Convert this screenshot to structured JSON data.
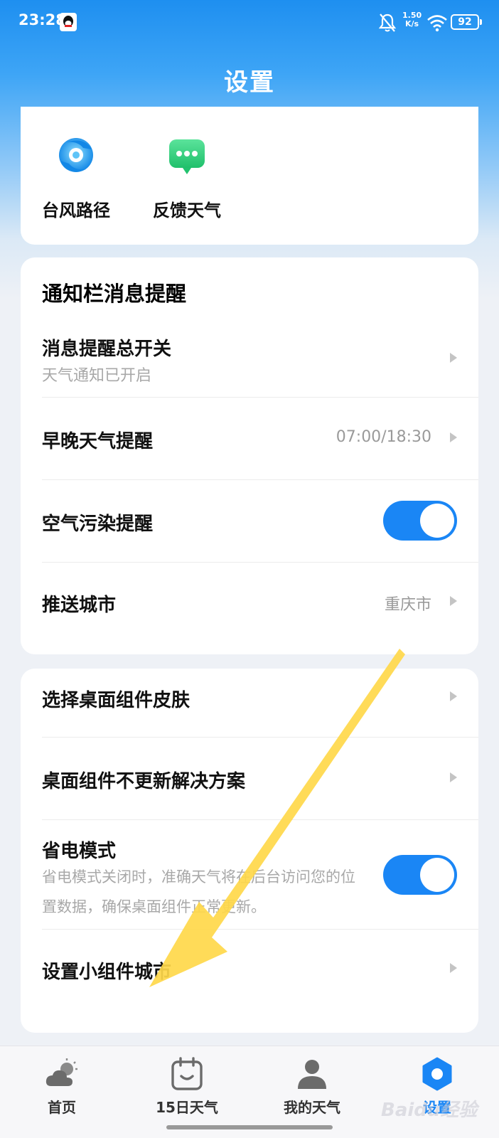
{
  "status_bar": {
    "time": "23:28",
    "net_speed_value": "1.50",
    "net_speed_unit": "K/s",
    "battery": "92"
  },
  "page": {
    "title": "设置"
  },
  "tools": [
    {
      "label": "台风路径",
      "icon": "typhoon-icon"
    },
    {
      "label": "反馈天气",
      "icon": "chat-bubble-icon"
    }
  ],
  "notify_card": {
    "title": "通知栏消息提醒",
    "rows": [
      {
        "label": "消息提醒总开关",
        "sub": "天气通知已开启"
      },
      {
        "label": "早晚天气提醒",
        "value": "07:00/18:30"
      },
      {
        "label": "空气污染提醒",
        "toggle_on": true
      },
      {
        "label": "推送城市",
        "value": "重庆市"
      }
    ]
  },
  "widget_card": {
    "rows": [
      {
        "label": "选择桌面组件皮肤"
      },
      {
        "label": "桌面组件不更新解决方案"
      },
      {
        "label": "省电模式",
        "desc": "省电模式关闭时，准确天气将在后台访问您的位置数据，确保桌面组件正常更新。",
        "toggle_on": true
      },
      {
        "label": "设置小组件城市"
      }
    ]
  },
  "bottom_nav": [
    {
      "label": "首页",
      "icon": "cloud-sun-icon"
    },
    {
      "label": "15日天气",
      "icon": "calendar-icon"
    },
    {
      "label": "我的天气",
      "icon": "person-icon"
    },
    {
      "label": "设置",
      "icon": "settings-hexagon-icon",
      "active": true
    }
  ],
  "colors": {
    "accent": "#1a86f5",
    "annotation_arrow": "#ffd84a"
  },
  "watermark": "Baidu经验"
}
